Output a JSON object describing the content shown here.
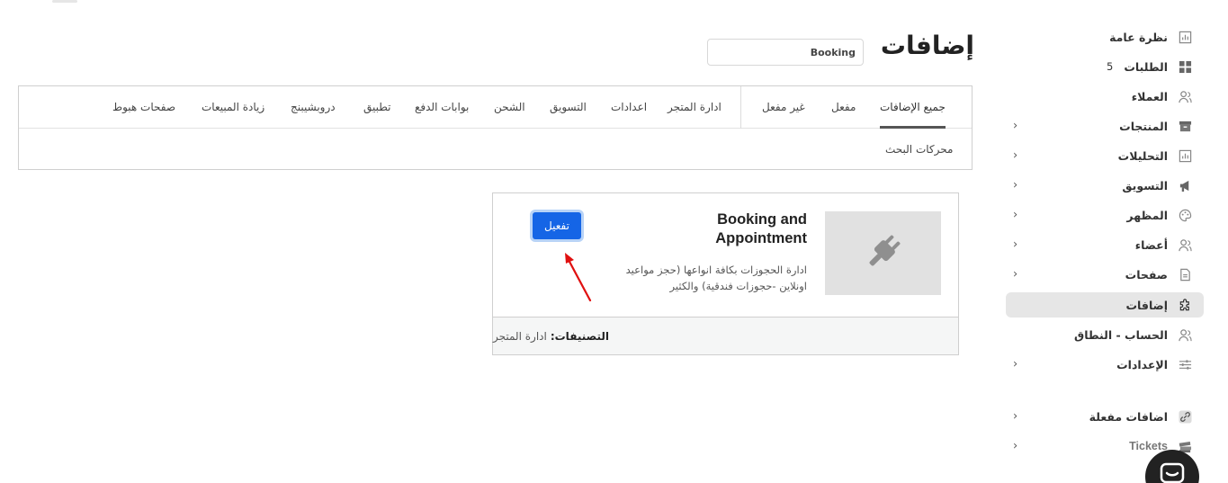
{
  "header": {
    "title": "إضافات",
    "search_value": "Booking"
  },
  "tabs": {
    "items": [
      "جميع الإضافات",
      "مفعل",
      "غير مفعل",
      "ادارة المتجر",
      "اعدادات",
      "التسويق",
      "الشحن",
      "بوابات الدفع",
      "تطبيق",
      "دروبشيبنج",
      "زيادة المبيعات",
      "صفحات هبوط"
    ],
    "row2": [
      "محركات البحث"
    ],
    "active_index": 0
  },
  "card": {
    "title": "Booking and Appointment",
    "description": "ادارة الحجوزات بكافة انواعها (حجز مواعيد اونلاين -حجوزات فندقية) والكثير",
    "activate_label": "تفعيل",
    "category_key": "التصنيفات:",
    "category_value": "ادارة المتجر",
    "thumb_icon": "plug-icon"
  },
  "sidebar": {
    "items": [
      {
        "label": "نظرة عامة",
        "icon": "chart-icon"
      },
      {
        "label": "الطلبات",
        "icon": "grid-icon",
        "badge": "5"
      },
      {
        "label": "العملاء",
        "icon": "users-icon"
      },
      {
        "label": "المنتجات",
        "icon": "box-icon",
        "chevron": true
      },
      {
        "label": "التحليلات",
        "icon": "chart-icon",
        "chevron": true
      },
      {
        "label": "التسويق",
        "icon": "megaphone-icon",
        "chevron": true
      },
      {
        "label": "المظهر",
        "icon": "palette-icon",
        "chevron": true
      },
      {
        "label": "أعضاء",
        "icon": "users-icon",
        "chevron": true
      },
      {
        "label": "صفحات",
        "icon": "page-icon",
        "chevron": true
      },
      {
        "label": "إضافات",
        "icon": "puzzle-icon",
        "active": true
      },
      {
        "label": "الحساب - النطاق",
        "icon": "users-icon"
      },
      {
        "label": "الإعدادات",
        "icon": "sliders-icon",
        "chevron": true
      },
      {
        "label": "اضافات مفعلة",
        "icon": "link-icon",
        "chevron": true
      },
      {
        "label": "Tickets",
        "icon": "tickets-icon",
        "chevron": true
      }
    ]
  },
  "colors": {
    "accent": "#1565e6",
    "arrow": "#e01010",
    "active_bg": "#e6e6e6"
  }
}
